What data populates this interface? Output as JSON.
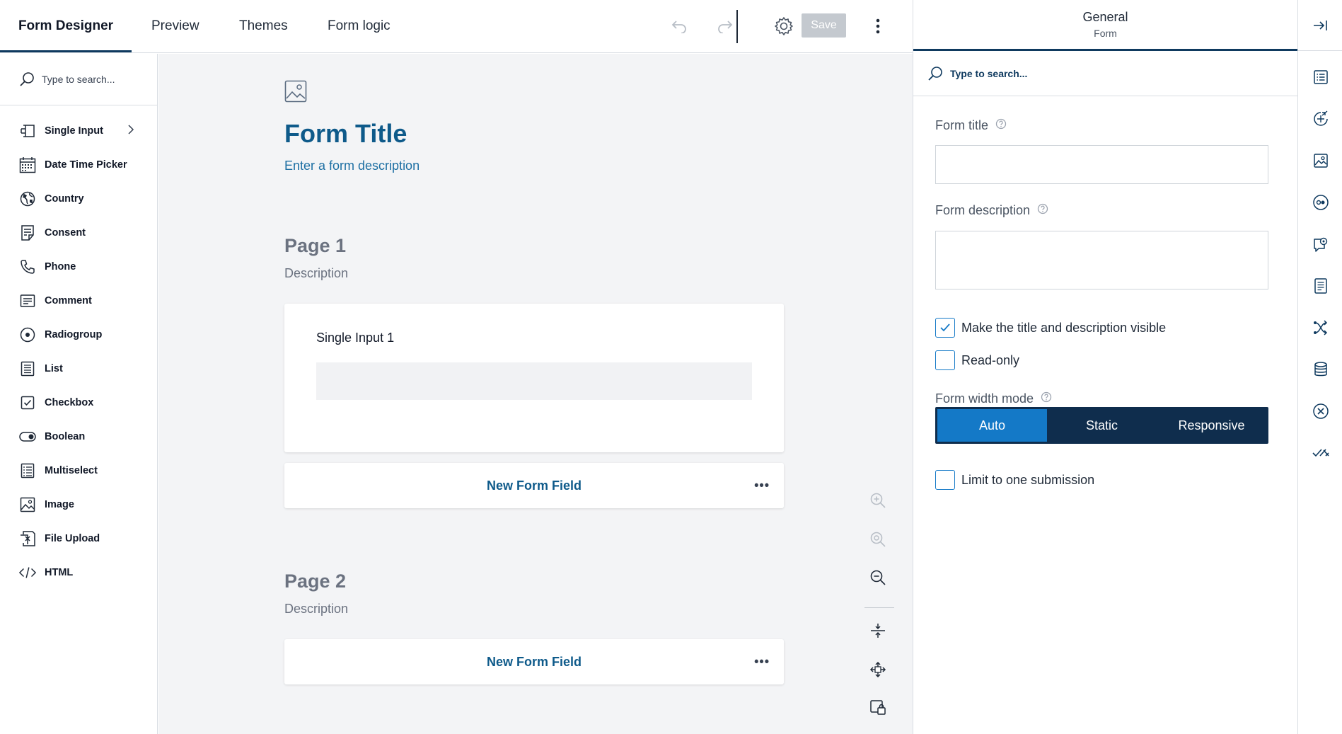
{
  "tabs": [
    {
      "label": "Form Designer",
      "active": true
    },
    {
      "label": "Preview"
    },
    {
      "label": "Themes"
    },
    {
      "label": "Form logic"
    }
  ],
  "toolbar": {
    "save_label": "Save"
  },
  "toolbox": {
    "search_placeholder": "Type to search...",
    "items": [
      {
        "label": "Single Input",
        "icon": "single-input-icon"
      },
      {
        "label": "Date Time Picker",
        "icon": "calendar-icon"
      },
      {
        "label": "Country",
        "icon": "globe-icon"
      },
      {
        "label": "Consent",
        "icon": "document-icon"
      },
      {
        "label": "Phone",
        "icon": "phone-icon"
      },
      {
        "label": "Comment",
        "icon": "comment-icon"
      },
      {
        "label": "Radiogroup",
        "icon": "radio-icon"
      },
      {
        "label": "List",
        "icon": "list-icon"
      },
      {
        "label": "Checkbox",
        "icon": "checkbox-icon"
      },
      {
        "label": "Boolean",
        "icon": "toggle-icon"
      },
      {
        "label": "Multiselect",
        "icon": "multiselect-icon"
      },
      {
        "label": "Image",
        "icon": "image-icon"
      },
      {
        "label": "File Upload",
        "icon": "file-upload-icon"
      },
      {
        "label": "HTML",
        "icon": "code-icon"
      }
    ]
  },
  "canvas": {
    "form_title": "Form Title",
    "form_description": "Enter a form description",
    "pages": [
      {
        "title": "Page 1",
        "description": "Description",
        "question_title": "Single Input 1",
        "new_field": "New Form Field"
      },
      {
        "title": "Page 2",
        "description": "Description",
        "new_field": "New Form Field"
      }
    ],
    "more": "•••"
  },
  "properties": {
    "title": "General",
    "subtitle": "Form",
    "search_placeholder": "Type to search...",
    "form_title_label": "Form title",
    "form_title_value": "",
    "form_description_label": "Form description",
    "form_description_value": "",
    "visible_label": "Make the title and description visible",
    "visible_checked": true,
    "readonly_label": "Read-only",
    "readonly_checked": false,
    "width_mode_label": "Form width mode",
    "width_modes": [
      "Auto",
      "Static",
      "Responsive"
    ],
    "width_mode_selected": "Auto",
    "limit_label": "Limit to one submission",
    "limit_checked": false
  },
  "colors": {
    "accent": "#1479C7",
    "brand_dark": "#0F2D4D",
    "title_blue": "#0E5A8A"
  }
}
